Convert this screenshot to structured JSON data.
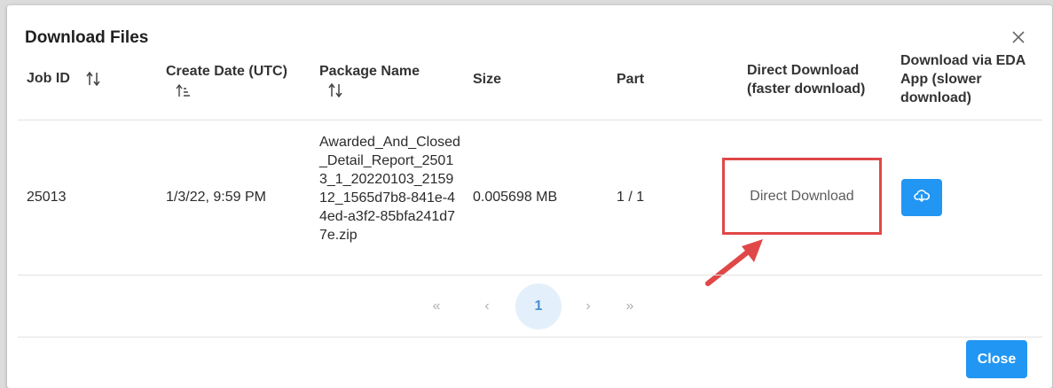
{
  "dialog": {
    "title": "Download Files",
    "close_icon": "close-icon",
    "close_button_label": "Close"
  },
  "table": {
    "headers": {
      "job_id": "Job ID",
      "create_date": "Create Date (UTC)",
      "package_name": "Package Name",
      "size": "Size",
      "part": "Part",
      "direct_download": "Direct Download (faster download)",
      "eda_download": "Download via EDA App (slower download)"
    },
    "rows": [
      {
        "job_id": "25013",
        "create_date": "1/3/22, 9:59 PM",
        "package_name": "Awarded_And_Closed_Detail_Report_25013_1_20220103_215912_1565d7b8-841e-44ed-a3f2-85bfa241d77e.zip",
        "size": "0.005698 MB",
        "part": "1 / 1",
        "direct_download_label": "Direct Download",
        "eda_icon": "cloud-download-icon"
      }
    ]
  },
  "pagination": {
    "first": "«",
    "prev": "‹",
    "current": "1",
    "next": "›",
    "last": "»"
  },
  "colors": {
    "primary": "#2196f3",
    "highlight": "#e04848",
    "active_page_bg": "#e3f0fb"
  }
}
